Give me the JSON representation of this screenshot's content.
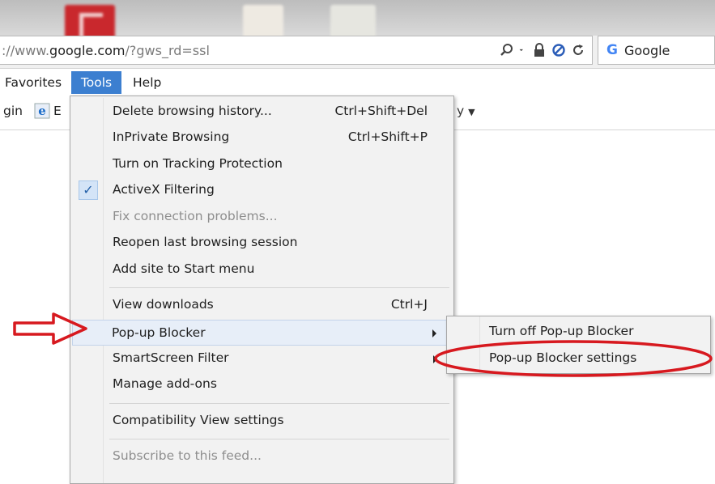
{
  "address_bar": {
    "url_prefix": "://www.",
    "url_domain": "google.com",
    "url_suffix": "/?gws_rd=ssl",
    "search_provider": "Google",
    "search_logo": "G"
  },
  "menubar": {
    "items": [
      {
        "label": "Favorites"
      },
      {
        "label": "Tools",
        "active": true
      },
      {
        "label": "Help"
      }
    ]
  },
  "favorites_bar": {
    "login_fragment": "gin",
    "ea_fragment": "E",
    "right_fragment": "y"
  },
  "tools_menu": {
    "items": [
      {
        "label": "Delete browsing history...",
        "shortcut": "Ctrl+Shift+Del"
      },
      {
        "label": "InPrivate Browsing",
        "shortcut": "Ctrl+Shift+P"
      },
      {
        "label": "Turn on Tracking Protection"
      },
      {
        "label": "ActiveX Filtering",
        "checked": true
      },
      {
        "label": "Fix connection problems...",
        "disabled": true
      },
      {
        "label": "Reopen last browsing session"
      },
      {
        "label": "Add site to Start menu"
      },
      {
        "label": "View downloads",
        "shortcut": "Ctrl+J"
      },
      {
        "label": "Pop-up Blocker",
        "submenu": true,
        "highlighted": true
      },
      {
        "label": "SmartScreen Filter",
        "submenu": true
      },
      {
        "label": "Manage add-ons"
      },
      {
        "label": "Compatibility View settings"
      },
      {
        "label": "Subscribe to this feed...",
        "disabled": true
      }
    ]
  },
  "popup_submenu": {
    "items": [
      {
        "label": "Turn off Pop-up Blocker"
      },
      {
        "label": "Pop-up Blocker settings"
      }
    ]
  },
  "icons": {
    "search": "magnifier-icon",
    "lock": "lock-icon",
    "block": "blocked-icon",
    "refresh": "refresh-icon",
    "ie": "internet-explorer-icon",
    "check": "checkmark-icon"
  },
  "colors": {
    "tools_active_bg": "#3c7fd0",
    "menu_bg": "#f2f2f2",
    "highlight_bg": "#e7eef8",
    "annotation_red": "#d7191f"
  }
}
